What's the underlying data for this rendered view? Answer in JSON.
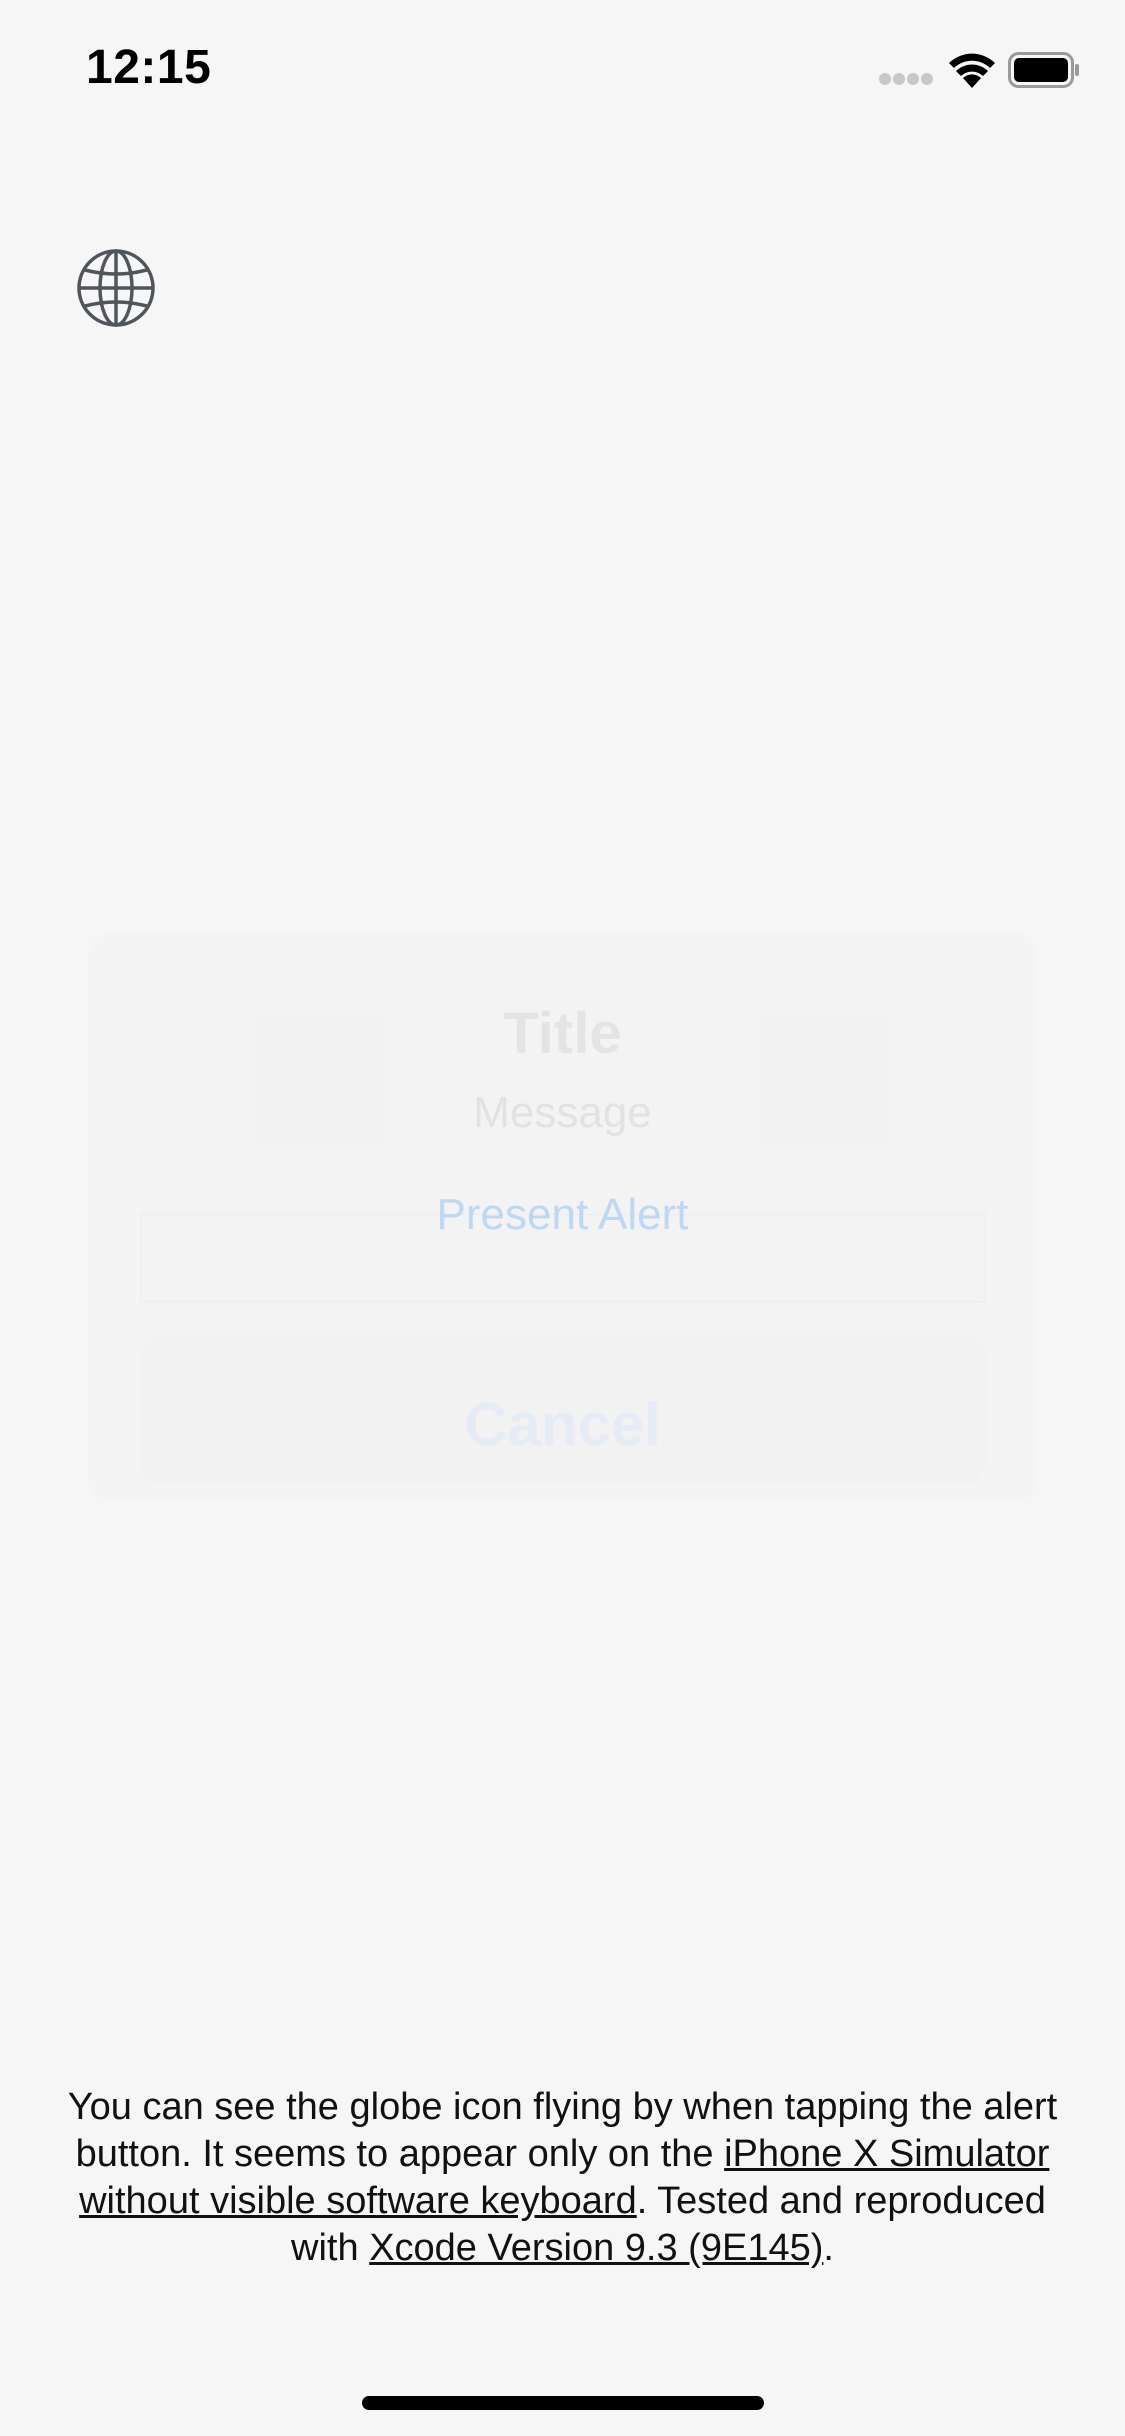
{
  "status_bar": {
    "time": "12:15",
    "icons": [
      "signal-dots-icon",
      "wifi-icon",
      "battery-icon"
    ]
  },
  "globe": {
    "icon": "globe-icon"
  },
  "alert": {
    "title": "Title",
    "message": "Message",
    "action_label": "Present Alert",
    "cancel_label": "Cancel"
  },
  "explanation": {
    "text_1": "You can see the globe icon flying by when tapping the alert button. It seems to appear only on the ",
    "link_1": "iPhone X Simulator without visible software keyboard",
    "text_2": ". Tested and reproduced with ",
    "link_2": "Xcode Version 9.3 (9E145)",
    "text_3": "."
  },
  "colors": {
    "background": "#f6f6f6",
    "alert_action": "#bcd8f4",
    "text": "#111111"
  }
}
